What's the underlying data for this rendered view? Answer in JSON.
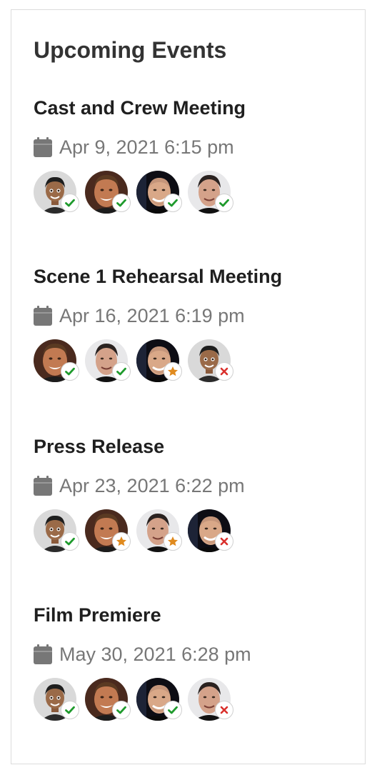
{
  "widget": {
    "title": "Upcoming Events"
  },
  "colors": {
    "going": "#1e9a2c",
    "maybe": "#e08a1e",
    "declined": "#d9302c",
    "text": "#1f1f1f",
    "muted": "#777777"
  },
  "events": [
    {
      "title": "Cast and Crew Meeting",
      "date": "Apr 9, 2021 6:15 pm",
      "attendees": [
        {
          "avatar": "avatar-cartoon-man",
          "status": "going"
        },
        {
          "avatar": "avatar-man-smiling",
          "status": "going"
        },
        {
          "avatar": "avatar-bald-man",
          "status": "going"
        },
        {
          "avatar": "avatar-older-man",
          "status": "going"
        }
      ]
    },
    {
      "title": "Scene 1 Rehearsal Meeting",
      "date": "Apr 16, 2021 6:19 pm",
      "attendees": [
        {
          "avatar": "avatar-man-smiling",
          "status": "going"
        },
        {
          "avatar": "avatar-older-man",
          "status": "going"
        },
        {
          "avatar": "avatar-bald-man",
          "status": "maybe"
        },
        {
          "avatar": "avatar-cartoon-man",
          "status": "declined"
        }
      ]
    },
    {
      "title": "Press Release",
      "date": "Apr 23, 2021 6:22 pm",
      "attendees": [
        {
          "avatar": "avatar-cartoon-man",
          "status": "going"
        },
        {
          "avatar": "avatar-man-smiling",
          "status": "maybe"
        },
        {
          "avatar": "avatar-older-man",
          "status": "maybe"
        },
        {
          "avatar": "avatar-bald-man",
          "status": "declined"
        }
      ]
    },
    {
      "title": "Film Premiere",
      "date": "May 30, 2021 6:28 pm",
      "attendees": [
        {
          "avatar": "avatar-cartoon-man",
          "status": "going"
        },
        {
          "avatar": "avatar-man-smiling",
          "status": "going"
        },
        {
          "avatar": "avatar-bald-man",
          "status": "going"
        },
        {
          "avatar": "avatar-older-man",
          "status": "declined"
        }
      ]
    }
  ]
}
